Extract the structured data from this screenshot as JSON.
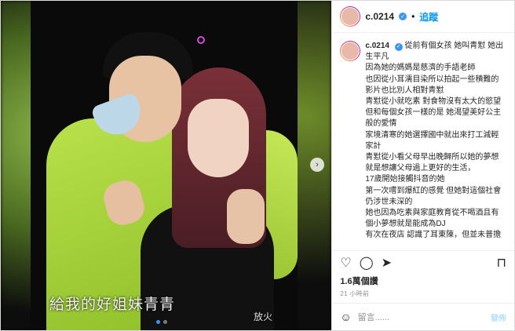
{
  "media": {
    "overlay_text": "給我的好姐妹青青",
    "signature": "放火",
    "slides": 2,
    "active_slide": 1
  },
  "header": {
    "username": "c.0214",
    "follow_label": "追蹤"
  },
  "caption": {
    "username": "c.0214",
    "text": "從前有個女孩 她叫青懟 她出生平凡\n因為她的媽媽是慈濟的手語老師\n也因從小耳濡目染所以拍起一些積難的影片也比別人相對青懟\n青懟從小就吃素 對食物沒有太大的慾望\n但和每個女孩一樣的是 她渴望美好公主般的愛情\n家境清寒的她選擇國中就出來打工減輕家計\n青懟從小看父母早出晚歸所以她的夢想就是想讓父母過上更好的生活，\n17歲開始接觸抖音的她\n第一次嚐到爆紅的感覺 但她對這個社會仍涉世未深的\n她也因為吃素與家庭教育從不喝酒且有個小夢想就是能成為DJ\n有次在夜店 認識了耳東陳，但並未普擔"
  },
  "stats": {
    "likes": "1.6萬個讚",
    "time_ago": "21 小時前"
  },
  "comment": {
    "placeholder": "留言......",
    "post_label": "發佈"
  },
  "icons": [
    "heart-icon",
    "comment-icon",
    "share-icon",
    "bookmark-icon",
    "emoji-icon",
    "more-icon",
    "next-arrow-icon",
    "verified-badge-icon"
  ]
}
